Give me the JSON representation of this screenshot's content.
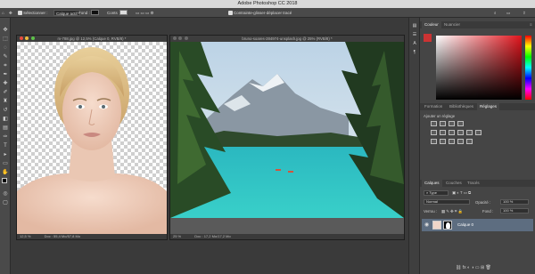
{
  "app": {
    "title": "Adobe Photoshop CC 2018"
  },
  "options_bar": {
    "tool_label": "Sélectionner :",
    "layer_select": "Calque actif",
    "color_label": "Fond :",
    "conts_label": "Conts",
    "toggle_label": "Contrainte-glisser-déplacer tracé"
  },
  "windows": {
    "portrait": {
      "title": "m-788.jpg @ 12,5% (Calque 0, RVB/8) *",
      "zoom": "12,5 %",
      "doc": "Doc : 55,4 Mo/57,8 Mo"
    },
    "landscape": {
      "title": "bruno-soares-284974-unsplash.jpg @ 25% (RVB/8) *",
      "zoom": "25 %",
      "doc": "Doc : 17,2 Mo/17,2 Mo"
    }
  },
  "panels": {
    "color_tabs": [
      "Couleur",
      "Nuancier"
    ],
    "adjust_tabs": [
      "Formation",
      "Bibliothèques",
      "Réglages"
    ],
    "adjust_title": "Ajouter un réglage",
    "layers_tabs": [
      "Calques",
      "Couches",
      "Tracés"
    ],
    "kind": "Type",
    "blend": "Normal",
    "opacity_label": "Opacité :",
    "opacity": "100 %",
    "lock_label": "Verrou :",
    "fill_label": "Fond :",
    "fill": "100 %",
    "layer_name": "Calque 0"
  },
  "colors": {
    "accent": "#5d6d80",
    "brand": "#2a6fb6"
  }
}
